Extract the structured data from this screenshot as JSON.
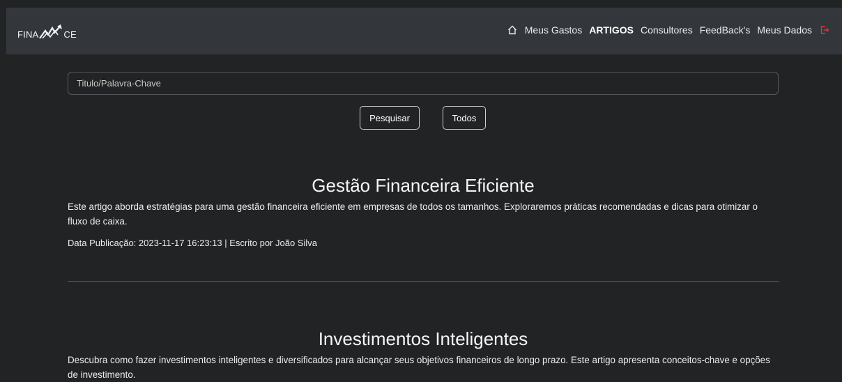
{
  "brand": {
    "text_left": "FINA",
    "text_right": "CE",
    "logo_icon": "chart-arrow-up-icon"
  },
  "nav": {
    "home_icon": "home-icon",
    "items": [
      {
        "label": "Meus Gastos",
        "active": false
      },
      {
        "label": "ARTIGOS",
        "active": true
      },
      {
        "label": "Consultores",
        "active": false
      },
      {
        "label": "FeedBack's",
        "active": false
      },
      {
        "label": "Meus Dados",
        "active": false
      }
    ],
    "logout_icon": "logout-icon",
    "logout_color": "#dc3545"
  },
  "search": {
    "placeholder": "Titulo/Palavra-Chave",
    "value": "",
    "search_button": "Pesquisar",
    "all_button": "Todos"
  },
  "articles": [
    {
      "title": "Gestão Financeira Eficiente",
      "description": "Este artigo aborda estratégias para uma gestão financeira eficiente em empresas de todos os tamanhos. Exploraremos práticas recomendadas e dicas para otimizar o fluxo de caixa.",
      "meta": "Data Publicação: 2023-11-17 16:23:13 | Escrito por João Silva"
    },
    {
      "title": "Investimentos Inteligentes",
      "description": "Descubra como fazer investimentos inteligentes e diversificados para alcançar seus objetivos financeiros de longo prazo. Este artigo apresenta conceitos-chave e opções de investimento."
    }
  ],
  "colors": {
    "background": "#222325",
    "navbar": "#33373b",
    "text": "#ffffff",
    "border": "#55595d"
  }
}
